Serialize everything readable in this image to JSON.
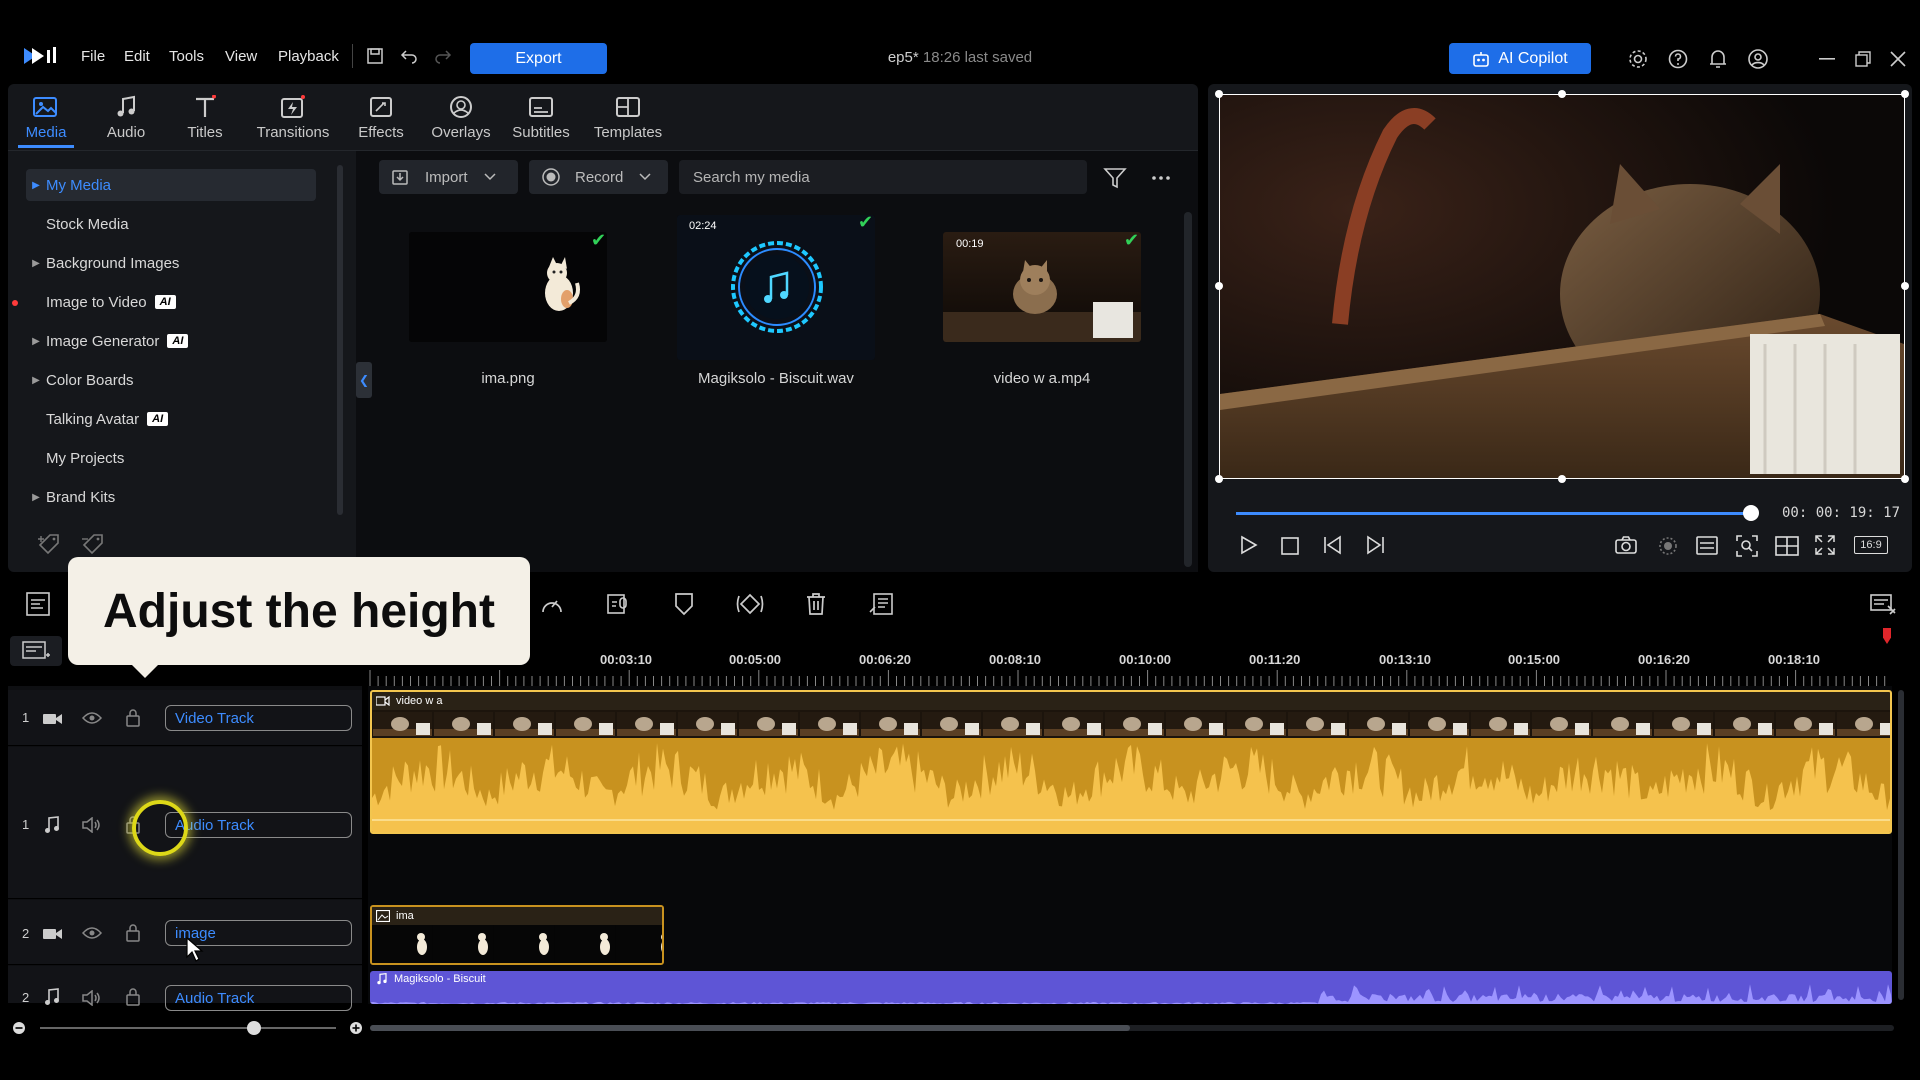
{
  "app": {
    "logo": "powerdirector-logo",
    "menus": [
      "File",
      "Edit",
      "Tools",
      "View",
      "Playback"
    ]
  },
  "toolbar": {
    "export_label": "Export",
    "project_name": "ep5*",
    "saved_text": "18:26 last saved",
    "copilot_label": "AI Copilot"
  },
  "tabs": [
    {
      "label": "Media",
      "icon": "media-icon",
      "active": true
    },
    {
      "label": "Audio",
      "icon": "music-note-icon"
    },
    {
      "label": "Titles",
      "icon": "title-t-icon",
      "dot": true
    },
    {
      "label": "Transitions",
      "icon": "transition-icon",
      "dot": true
    },
    {
      "label": "Effects",
      "icon": "effects-icon"
    },
    {
      "label": "Overlays",
      "icon": "overlay-icon"
    },
    {
      "label": "Subtitles",
      "icon": "subtitles-icon"
    },
    {
      "label": "Templates",
      "icon": "templates-icon"
    }
  ],
  "sidebar": {
    "items": [
      {
        "label": "My Media",
        "arrow": true,
        "selected": true
      },
      {
        "label": "Stock Media"
      },
      {
        "label": "Background Images",
        "arrow": true
      },
      {
        "label": "Image to Video",
        "ai": "AI",
        "dot": true
      },
      {
        "label": "Image Generator",
        "arrow": true,
        "ai": "AI"
      },
      {
        "label": "Color Boards",
        "arrow": true
      },
      {
        "label": "Talking Avatar",
        "ai": "AI"
      },
      {
        "label": "My Projects"
      },
      {
        "label": "Brand Kits",
        "arrow": true
      }
    ]
  },
  "library": {
    "import_label": "Import",
    "record_label": "Record",
    "search_placeholder": "Search my media",
    "items": [
      {
        "name": "ima.png",
        "duration": ""
      },
      {
        "name": "Magiksolo - Biscuit.wav",
        "duration": "02:24"
      },
      {
        "name": "video w a.mp4",
        "duration": "00:19"
      }
    ]
  },
  "preview": {
    "timecode": "00: 00: 19: 17",
    "aspect": "16:9",
    "progress": 0.91
  },
  "tooltip": {
    "text": "Adjust the height"
  },
  "timeline": {
    "ruler_labels": [
      "00:03:10",
      "00:05:00",
      "00:06:20",
      "00:08:10",
      "00:10:00",
      "00:11:20",
      "00:13:10",
      "00:15:00",
      "00:16:20",
      "00:18:10"
    ],
    "tracks": [
      {
        "number": "1",
        "name": "Video Track",
        "type": "video"
      },
      {
        "number": "1",
        "name": "Audio Track",
        "type": "audio"
      },
      {
        "number": "2",
        "name": "image",
        "type": "video"
      },
      {
        "number": "2",
        "name": "Audio Track",
        "type": "audio"
      }
    ],
    "clips": {
      "video": "video w a",
      "image": "ima",
      "music": "Magiksolo - Biscuit"
    }
  },
  "colors": {
    "accent": "#1e6ee8",
    "clip_audio": "#f3b844",
    "clip_music": "#6a5fe0"
  }
}
